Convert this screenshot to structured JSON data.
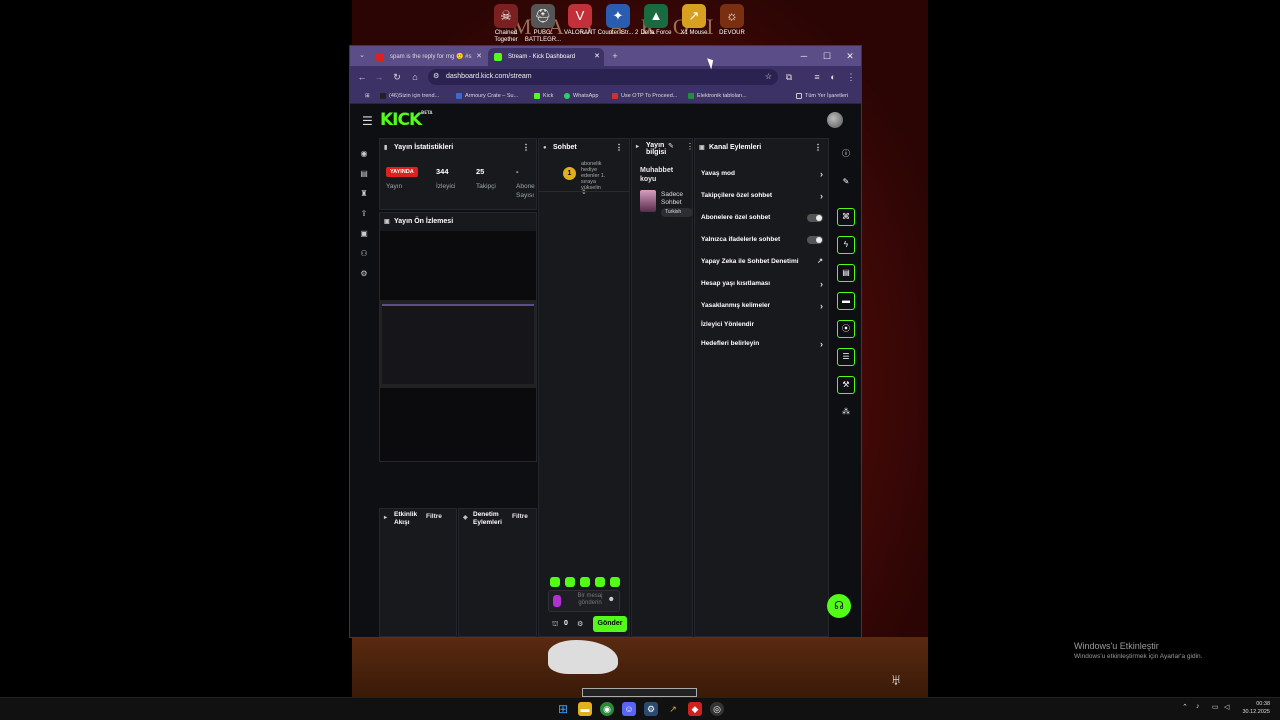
{
  "desktop": {
    "wallpaper_text": "M A  S  A R   O  I",
    "icons": [
      {
        "label": "Chained Together",
        "color": "#7a2020",
        "glyph": "☠"
      },
      {
        "label": "PUBG: BATTLEGR...",
        "color": "#555555",
        "glyph": "⛑"
      },
      {
        "label": "VALORANT",
        "color": "#c2303a",
        "glyph": "V"
      },
      {
        "label": "Counter-Str... 2",
        "color": "#2a5db0",
        "glyph": "✦"
      },
      {
        "label": "Delta Force",
        "color": "#1a6a40",
        "glyph": "▲"
      },
      {
        "label": "X1 Mouse",
        "color": "#d8a020",
        "glyph": "↗"
      },
      {
        "label": "DEVOUR",
        "color": "#7a3010",
        "glyph": "☼"
      }
    ]
  },
  "browser": {
    "tabs": [
      {
        "title": "spam is the reply for rng 🙂 #s",
        "favicon_color": "#e02020",
        "active": false
      },
      {
        "title": "Stream - Kick Dashboard",
        "favicon_color": "#53fc18",
        "active": true
      }
    ],
    "new_tab": "+",
    "url": "dashboard.kick.com/stream",
    "bookmarks": [
      {
        "label": "(46)Sizin için trend...",
        "color": "#222222"
      },
      {
        "label": "Armoury Crate – Su...",
        "color": "#3a6ad0"
      },
      {
        "label": "Kick",
        "color": "#53fc18"
      },
      {
        "label": "WhatsApp",
        "color": "#25d366"
      },
      {
        "label": "Use OTP To Proceed...",
        "color": "#d03030"
      },
      {
        "label": "Elektronik tabloları...",
        "color": "#1e8e3e"
      }
    ],
    "bookmarks_all": "Tüm Yer İşaretleri"
  },
  "kick": {
    "logo": "KICK",
    "logo_badge": "BETA",
    "stats_panel": {
      "title": "Yayın İstatistikleri",
      "live_badge": "YAYINDA",
      "live_label": "Yayın",
      "viewers_value": "344",
      "viewers_label": "İzleyici",
      "followers_value": "25",
      "followers_label": "Takipçi",
      "subs_value": "-",
      "subs_label": "Abone Sayısı"
    },
    "preview_panel": {
      "title": "Yayın Ön İzlemesi"
    },
    "activity_panel": {
      "title": "Etkinlik Akışı",
      "filter": "Filtre"
    },
    "moderation_panel": {
      "title": "Denetim Eylemleri",
      "filter": "Filtre"
    },
    "chat_panel": {
      "title": "Sohbet",
      "pinned_rank": "1",
      "pinned_text": "abonelik hediye edenler 1. sıraya yükselin",
      "input_placeholder": "Bir mesaj gönderin",
      "points": "0",
      "send": "Gönder"
    },
    "stream_info_panel": {
      "title": "Yayın bilgisi",
      "stream_title": "Muhabbet koyu",
      "category": "Sadece Sohbet",
      "tag": "Turkish"
    },
    "channel_actions_panel": {
      "title": "Kanal Eylemleri",
      "items": [
        {
          "label": "Yavaş mod",
          "control": "chevron"
        },
        {
          "label": "Takipçilere özel sohbet",
          "control": "chevron"
        },
        {
          "label": "Abonelere özel sohbet",
          "control": "toggle"
        },
        {
          "label": "Yalnızca ifadelerle sohbet",
          "control": "toggle"
        },
        {
          "label": "Yapay Zeka ile Sohbet Denetimi",
          "control": "external"
        },
        {
          "label": "Hesap yaşı kısıtlaması",
          "control": "chevron"
        },
        {
          "label": "Yasaklanmış kelimeler",
          "control": "chevron"
        },
        {
          "label": "İzleyici Yönlendir",
          "control": "none"
        },
        {
          "label": "Hedefleri belirleyin",
          "control": "chevron"
        }
      ]
    }
  },
  "windows": {
    "activate_title": "Windows'u Etkinleştir",
    "activate_sub": "Windows'u etkinleştirmek için Ayarlar'a gidin.",
    "time": "00:38",
    "date": "30.12.2025"
  },
  "colors": {
    "accent": "#53fc18",
    "live": "#e0201e",
    "browser_chrome": "#3d3266"
  }
}
